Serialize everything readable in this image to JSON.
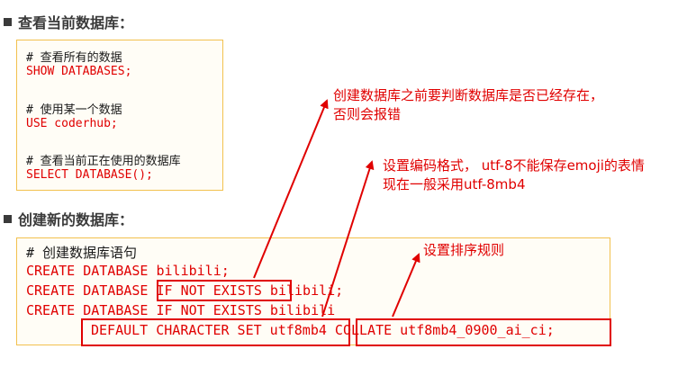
{
  "section1": {
    "heading": "查看当前数据库：",
    "lines": [
      {
        "text": "# 查看所有的数据",
        "kind": "comment"
      },
      {
        "text": "SHOW DATABASES;",
        "kind": "code"
      },
      {
        "text": "# 使用某一个数据",
        "kind": "comment"
      },
      {
        "text": "USE coderhub;",
        "kind": "code"
      },
      {
        "text": "# 查看当前正在使用的数据库",
        "kind": "comment"
      },
      {
        "text": "SELECT DATABASE();",
        "kind": "code"
      }
    ]
  },
  "section2": {
    "heading": "创建新的数据库：",
    "lines": [
      {
        "text": "# 创建数据库语句",
        "kind": "comment"
      },
      {
        "text": "CREATE DATABASE bilibili;",
        "kind": "code"
      },
      {
        "text": "CREATE DATABASE IF NOT EXISTS bilibili;",
        "kind": "code"
      },
      {
        "text": "CREATE DATABASE IF NOT EXISTS bilibili",
        "kind": "code"
      },
      {
        "text": "DEFAULT CHARACTER SET utf8mb4 COLLATE utf8mb4_0900_ai_ci;",
        "kind": "code"
      }
    ]
  },
  "annotations": {
    "if_not_exists": "创建数据库之前要判断数据库是否已经存在，\n否则会报错",
    "charset": "设置编码格式， utf-8不能保存emoji的表情\n现在一般采用utf-8mb4",
    "collate": "设置排序规则"
  },
  "colors": {
    "accent_red": "#e00000",
    "box_border": "#f2c14e",
    "heading": "#3a3a3a"
  }
}
